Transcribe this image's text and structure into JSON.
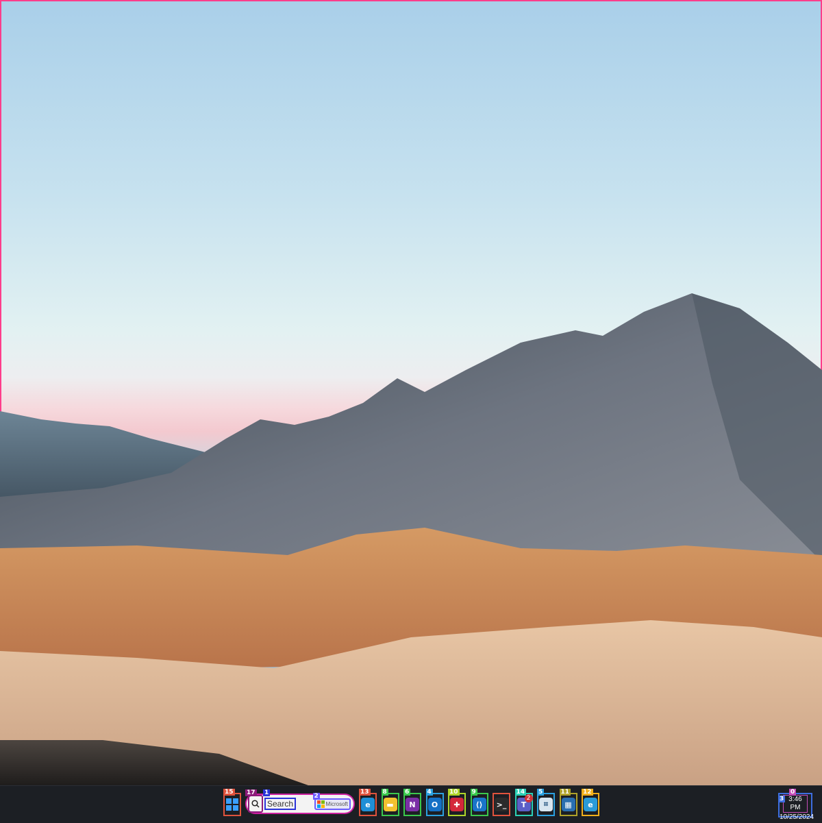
{
  "taskbar": {
    "search": {
      "placeholder": "Search",
      "brand_text": "Microsoft",
      "badge_search": "17",
      "badge_input": "1",
      "badge_brand": "2"
    },
    "start": {
      "badge": "15"
    },
    "apps": [
      {
        "id": "edge",
        "badge": "13",
        "icon": "edge-icon",
        "glyph": "e",
        "color": "#1f8fd6",
        "border": "#e0533d"
      },
      {
        "id": "file-explorer",
        "badge": "8",
        "icon": "folder-icon",
        "glyph": "▬",
        "color": "#f2c230",
        "border": "#3bc94d"
      },
      {
        "id": "onenote",
        "badge": "6",
        "icon": "onenote-icon",
        "glyph": "N",
        "color": "#7b2fa6",
        "border": "#3bc94d"
      },
      {
        "id": "outlook",
        "badge": "4",
        "icon": "outlook-icon",
        "glyph": "O",
        "color": "#1470c5",
        "border": "#2ba1e0"
      },
      {
        "id": "security",
        "badge": "10",
        "icon": "shield-icon",
        "glyph": "✚",
        "color": "#d4283a",
        "border": "#b0d62a"
      },
      {
        "id": "vscode",
        "badge": "9",
        "icon": "vscode-icon",
        "glyph": "⟨⟩",
        "color": "#1a75c9",
        "border": "#3bc94d"
      },
      {
        "id": "terminal",
        "badge": "",
        "icon": "terminal-icon",
        "glyph": ">_",
        "color": "#2b2b2b",
        "border": "#e0533d"
      },
      {
        "id": "teams",
        "badge": "14",
        "icon": "teams-icon",
        "glyph": "T",
        "color": "#5b5fc7",
        "border": "#2bd1b7",
        "notify": "2"
      },
      {
        "id": "monitor",
        "badge": "5",
        "icon": "monitor-icon",
        "glyph": "⌗",
        "color": "#d8e6f0",
        "border": "#2ba1e0"
      },
      {
        "id": "app-grid",
        "badge": "11",
        "icon": "grid-app-icon",
        "glyph": "▦",
        "color": "#2a6fb0",
        "border": "#b0a22a"
      },
      {
        "id": "edge-beta",
        "badge": "12",
        "icon": "edge-beta-icon",
        "glyph": "e",
        "color": "#2b9bd8",
        "border": "#f2b01b"
      }
    ],
    "clock": {
      "badge_tray": "3",
      "badge_clock": "0",
      "time": "3:46 PM",
      "date": "10/25/2024"
    }
  }
}
